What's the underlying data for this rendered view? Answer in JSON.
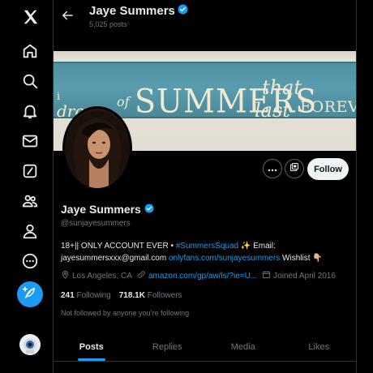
{
  "nav": {
    "items": [
      "x-logo-icon",
      "home-icon",
      "explore-icon",
      "notifications-icon",
      "messages-icon",
      "grok-icon",
      "communities-icon",
      "profile-icon",
      "more-icon"
    ],
    "post_icon": "feather-plus-icon"
  },
  "header": {
    "title": "Jaye Summers",
    "post_count": "5,025 posts"
  },
  "banner": {
    "w1": "i",
    "w2": "dream",
    "w3": "of",
    "w4": "SUMMERS",
    "w5": "that",
    "w6": "last",
    "w7": "FOREVER"
  },
  "profile": {
    "name": "Jaye Summers",
    "handle": "@sunjayesummers",
    "follow_label": "Follow",
    "bio_part1": "18+|| ONLY ACCOUNT EVER • ",
    "bio_hashtag": "#SummersSquad",
    "bio_part2": " ✨ Email: jayesummersxxx@gmail.com ",
    "bio_link": "onlyfans.com/sunjayesummers",
    "bio_part3": " Wishlist 👇🏼",
    "location": "Los Angeles, CA",
    "website": "amazon.com/gp/aw/ls/?ie=U...",
    "joined": "Joined April 2016",
    "following_count": "241",
    "following_label": "Following",
    "followers_count": "718.1K",
    "followers_label": "Followers",
    "not_followed": "Not followed by anyone you’re following"
  },
  "tabs": [
    {
      "label": "Posts",
      "active": true
    },
    {
      "label": "Replies",
      "active": false
    },
    {
      "label": "Media",
      "active": false
    },
    {
      "label": "Likes",
      "active": false
    }
  ],
  "colors": {
    "accent": "#1d9bf0",
    "background": "#000000",
    "muted": "#71767b",
    "border": "#2f3336"
  }
}
